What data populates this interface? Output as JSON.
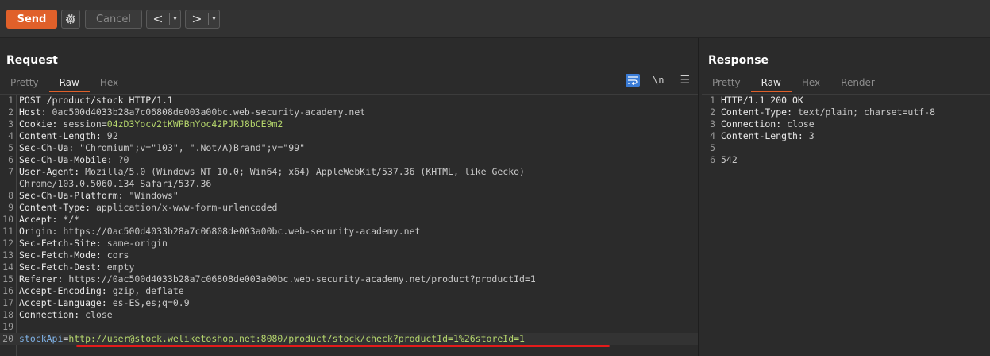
{
  "toolbar": {
    "send_label": "Send",
    "cancel_label": "Cancel",
    "back_arrow": "<",
    "forward_arrow": ">",
    "dropdown_glyph": "▾",
    "accent_color": "#e0602a"
  },
  "request": {
    "title": "Request",
    "tabs": [
      {
        "label": "Pretty",
        "active": false
      },
      {
        "label": "Raw",
        "active": true
      },
      {
        "label": "Hex",
        "active": false
      }
    ],
    "newline_toggle": "\\n",
    "lines": [
      {
        "n": "1",
        "key": "POST /product/stock HTTP/1.1",
        "val": ""
      },
      {
        "n": "2",
        "key": "Host: ",
        "val": "0ac500d4033b28a7c06808de003a00bc.web-security-academy.net"
      },
      {
        "n": "3",
        "key": "Cookie: ",
        "val": "session=",
        "cookie": "04zD3Yocv2tKWPBnYoc42PJRJ8bCE9m2"
      },
      {
        "n": "4",
        "key": "Content-Length: ",
        "val": "92"
      },
      {
        "n": "5",
        "key": "Sec-Ch-Ua: ",
        "val": "\"Chromium\";v=\"103\", \".Not/A)Brand\";v=\"99\""
      },
      {
        "n": "6",
        "key": "Sec-Ch-Ua-Mobile: ",
        "val": "?0"
      },
      {
        "n": "7",
        "key": "User-Agent: ",
        "val": "Mozilla/5.0 (Windows NT 10.0; Win64; x64) AppleWebKit/537.36 (KHTML, like Gecko)"
      },
      {
        "n": "",
        "key": "",
        "val": "Chrome/103.0.5060.134 Safari/537.36"
      },
      {
        "n": "8",
        "key": "Sec-Ch-Ua-Platform: ",
        "val": "\"Windows\""
      },
      {
        "n": "9",
        "key": "Content-Type: ",
        "val": "application/x-www-form-urlencoded"
      },
      {
        "n": "10",
        "key": "Accept: ",
        "val": "*/*"
      },
      {
        "n": "11",
        "key": "Origin: ",
        "val": "https://0ac500d4033b28a7c06808de003a00bc.web-security-academy.net"
      },
      {
        "n": "12",
        "key": "Sec-Fetch-Site: ",
        "val": "same-origin"
      },
      {
        "n": "13",
        "key": "Sec-Fetch-Mode: ",
        "val": "cors"
      },
      {
        "n": "14",
        "key": "Sec-Fetch-Dest: ",
        "val": "empty"
      },
      {
        "n": "15",
        "key": "Referer: ",
        "val": "https://0ac500d4033b28a7c06808de003a00bc.web-security-academy.net/product?productId=1"
      },
      {
        "n": "16",
        "key": "Accept-Encoding: ",
        "val": "gzip, deflate"
      },
      {
        "n": "17",
        "key": "Accept-Language: ",
        "val": "es-ES,es;q=0.9"
      },
      {
        "n": "18",
        "key": "Connection: ",
        "val": "close"
      },
      {
        "n": "19",
        "key": "",
        "val": ""
      },
      {
        "n": "20",
        "key": "",
        "val": "",
        "param": "stockApi",
        "eq": "=",
        "pvalue": "http://user@stock.weliketoshop.net:8080/product/stock/check?productId=1%26storeId=1"
      }
    ]
  },
  "response": {
    "title": "Response",
    "tabs": [
      {
        "label": "Pretty",
        "active": false
      },
      {
        "label": "Raw",
        "active": true
      },
      {
        "label": "Hex",
        "active": false
      },
      {
        "label": "Render",
        "active": false
      }
    ],
    "lines": [
      {
        "n": "1",
        "key": "HTTP/1.1 200 OK",
        "val": ""
      },
      {
        "n": "2",
        "key": "Content-Type: ",
        "val": "text/plain; charset=utf-8"
      },
      {
        "n": "3",
        "key": "Connection: ",
        "val": "close"
      },
      {
        "n": "4",
        "key": "Content-Length: ",
        "val": "3"
      },
      {
        "n": "5",
        "key": "",
        "val": ""
      },
      {
        "n": "6",
        "key": "",
        "val": "542"
      }
    ]
  }
}
